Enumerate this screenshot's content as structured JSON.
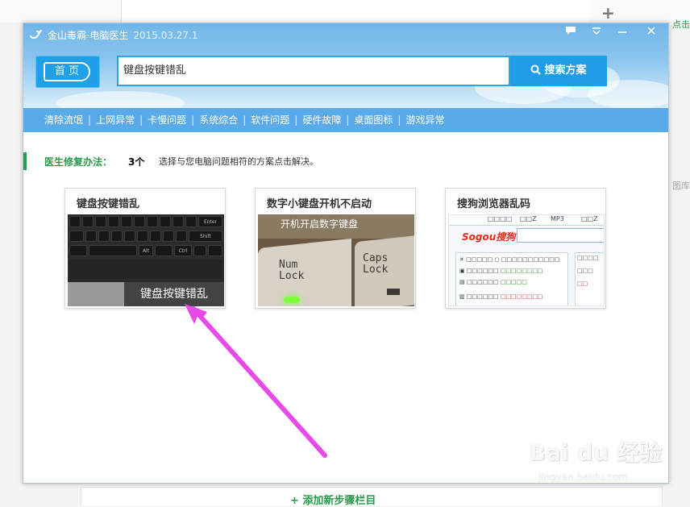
{
  "background": {
    "plus_icon": "plus-icon",
    "right_label": "点击",
    "right_label2": "图库",
    "add_step": "+ 添加新步骤栏目"
  },
  "window": {
    "app_name": "金山毒霸-电脑医生",
    "version": "2015.03.27.1",
    "controls": [
      "chat-icon",
      "menu-icon",
      "minimize-icon",
      "close-icon"
    ]
  },
  "header": {
    "home_label": "首 页",
    "search_value": "键盘按键错乱",
    "search_button": "搜索方案"
  },
  "categories": [
    "清除流氓",
    "上网异常",
    "卡慢问题",
    "系统综合",
    "软件问题",
    "硬件故障",
    "桌面图标",
    "游戏异常"
  ],
  "solutions": {
    "label": "医生修复办法：",
    "count": "3个",
    "hint": "选择与您电脑问题相符的方案点击解决。"
  },
  "cards": [
    {
      "title": "键盘按键错乱",
      "caption": "键盘按键错乱"
    },
    {
      "title": "数字小键盘开机不启动",
      "caption": "开机开启数字键盘",
      "key1": [
        "Num",
        "Lock"
      ],
      "key2": [
        "Caps",
        "Lock"
      ]
    },
    {
      "title": "搜狗浏览器乱码",
      "logo": "Sogou搜狗"
    }
  ],
  "watermark": {
    "brand": "Bai du 经验",
    "url": "jingyan.baidu.com"
  },
  "colors": {
    "accent": "#1f9de6",
    "category_bar": "#5aaae9",
    "green": "#2a9b4a",
    "arrow": "#e84ae8"
  }
}
